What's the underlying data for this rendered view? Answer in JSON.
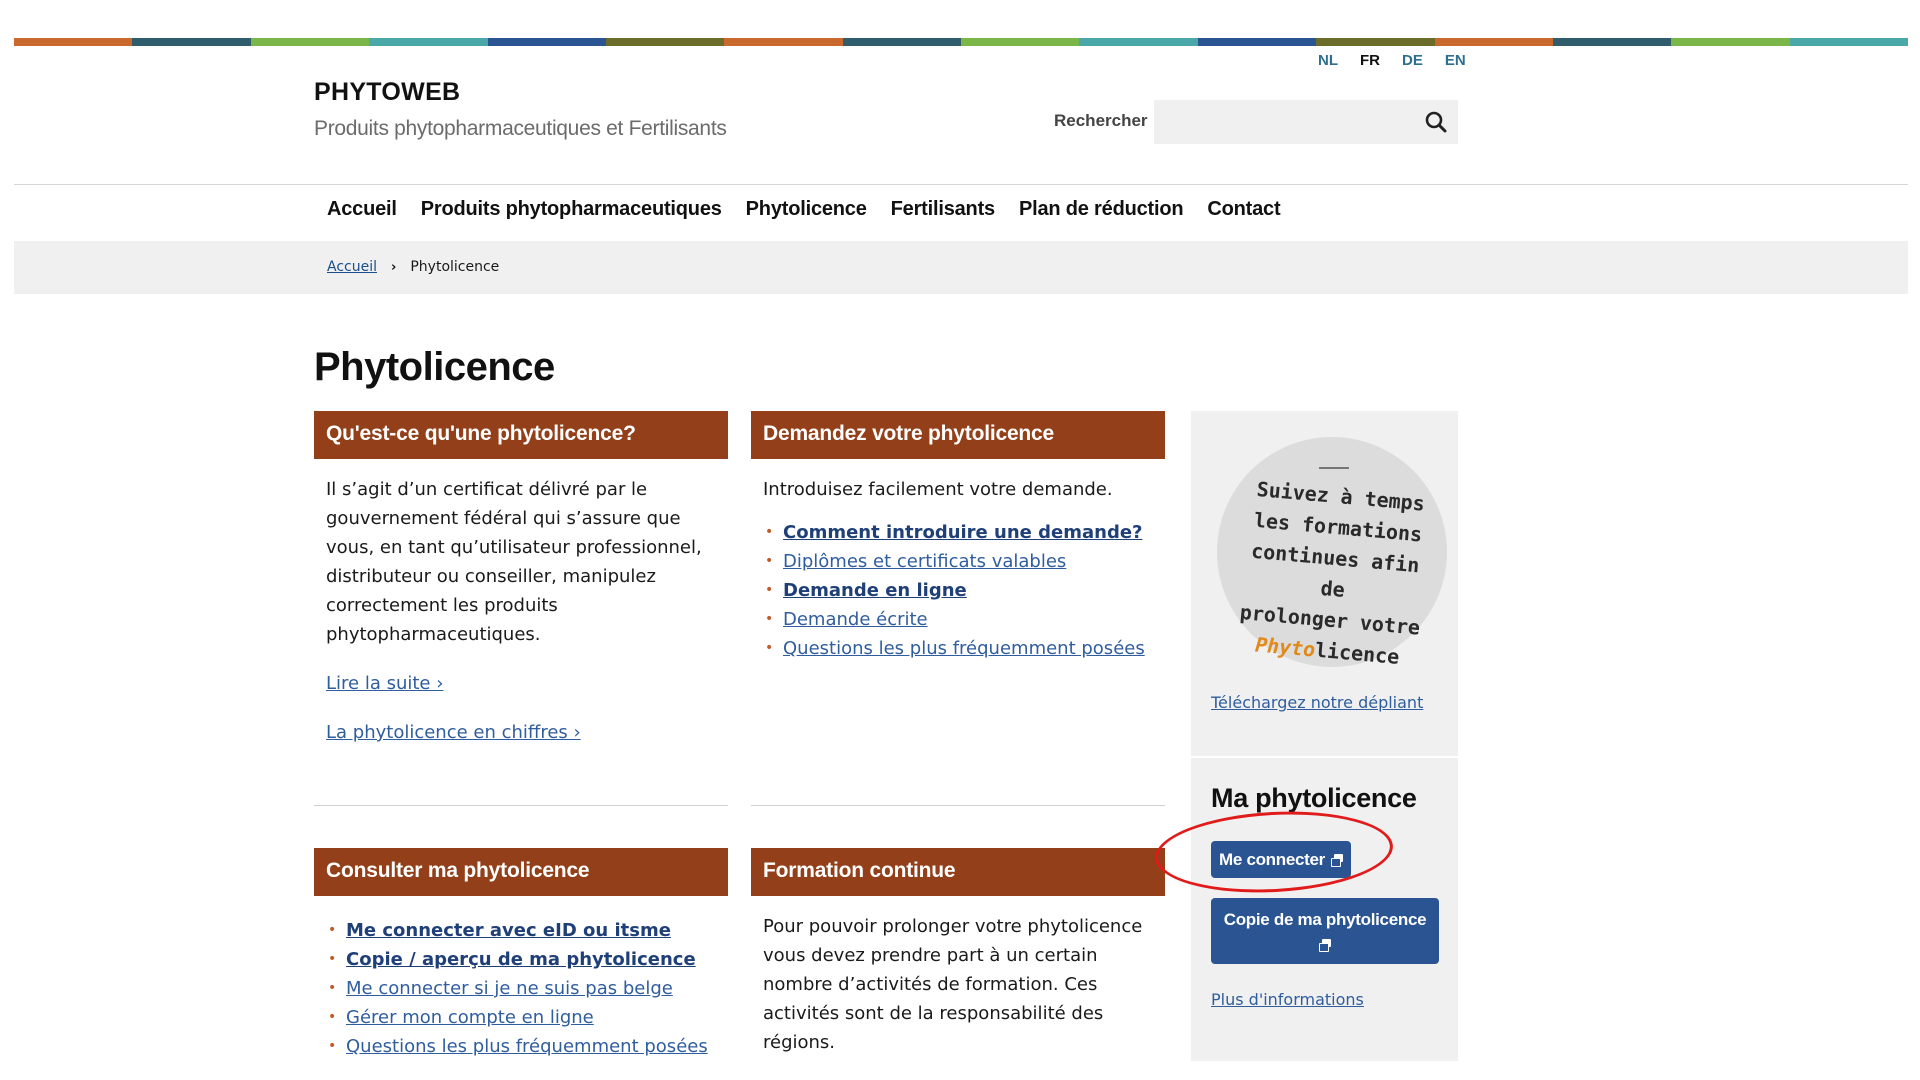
{
  "colors": {
    "stripe": [
      "#c9692d",
      "#2f5d6b",
      "#7ab648",
      "#4aa9a8",
      "#2a5592",
      "#6b6b2a",
      "#c9692d",
      "#2f5d6b",
      "#7ab648",
      "#4aa9a8",
      "#2a5592",
      "#6b6b2a",
      "#c9692d",
      "#2f5d6b",
      "#7ab648",
      "#4aa9a8"
    ],
    "card_header": "#93401a",
    "button": "#2a5592",
    "link": "#2f5d9e",
    "highlight": "#e11a1a"
  },
  "languages": [
    {
      "code": "NL",
      "active": false
    },
    {
      "code": "FR",
      "active": true
    },
    {
      "code": "DE",
      "active": false
    },
    {
      "code": "EN",
      "active": false
    }
  ],
  "site": {
    "title": "PHYTOWEB",
    "subtitle": "Produits phytopharmaceutiques et Fertilisants"
  },
  "search": {
    "label": "Rechercher",
    "value": "",
    "icon": "magnifier-icon"
  },
  "nav": [
    "Accueil",
    "Produits phytopharmaceutiques",
    "Phytolicence",
    "Fertilisants",
    "Plan de réduction",
    "Contact"
  ],
  "breadcrumb": {
    "home": "Accueil",
    "current": "Phytolicence"
  },
  "page_title": "Phytolicence",
  "cards": {
    "what": {
      "title": "Qu'est-ce qu'une phytolicence?",
      "text": "Il s’agit d’un certificat délivré par le gouvernement fédéral qui s’assure que vous, en tant qu’utilisateur professionnel, distributeur ou conseiller, manipulez correctement les produits phytopharmaceutiques.",
      "link1": "Lire la suite ›",
      "link2": "La phytolicence en chiffres ›"
    },
    "request": {
      "title": "Demandez votre phytolicence",
      "intro": "Introduisez facilement votre demande.",
      "items": [
        {
          "label": "Comment introduire une demande?",
          "strong": true
        },
        {
          "label": "Diplômes et certificats valables",
          "strong": false
        },
        {
          "label": "Demande en ligne",
          "strong": true
        },
        {
          "label": "Demande écrite",
          "strong": false
        },
        {
          "label": "Questions les plus fréquemment posées",
          "strong": false
        }
      ]
    },
    "consult": {
      "title": "Consulter ma phytolicence",
      "items": [
        {
          "label": "Me connecter avec eID ou itsme",
          "strong": true
        },
        {
          "label": "Copie / aperçu de ma phytolicence",
          "strong": true
        },
        {
          "label": "Me connecter si je ne suis pas belge",
          "strong": false
        },
        {
          "label": "Gérer mon compte en ligne",
          "strong": false
        },
        {
          "label": "Questions les plus fréquemment posées",
          "strong": false
        }
      ]
    },
    "training": {
      "title": "Formation continue",
      "text": "Pour pouvoir prolonger votre phytolicence vous devez prendre part à un certain nombre d’activités de formation. Ces activités sont de la responsabilité des régions."
    }
  },
  "sidebar": {
    "promo": {
      "line1": "Suivez à temps",
      "line2": "les formations",
      "line3": "continues afin de",
      "line4": "prolonger votre",
      "phyto": "Phyto",
      "licence": "licence"
    },
    "download_link": "Téléchargez notre dépliant",
    "heading": "Ma phytolicence",
    "connect_button": "Me connecter",
    "copy_button": "Copie de ma phytolicence",
    "info_link": "Plus d'informations"
  }
}
